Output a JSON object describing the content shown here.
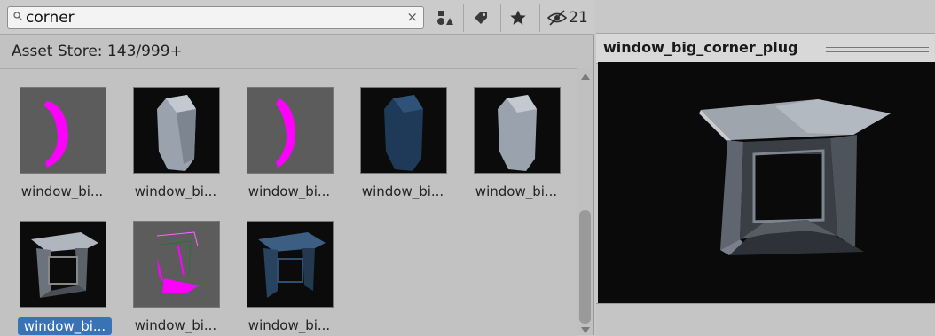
{
  "search": {
    "query": "corner",
    "placeholder": ""
  },
  "toolbar": {
    "clear_label": "×",
    "hidden_count": "21",
    "icons": [
      "search-icon",
      "clear-icon",
      "filter-by-type-icon",
      "filter-by-label-icon",
      "favorites-star-icon",
      "hidden-visibility-icon"
    ]
  },
  "asset_store": {
    "label": "Asset Store: 143/999+"
  },
  "assets": [
    {
      "label": "window_bi...",
      "thumb_style": "grey",
      "shape": "magenta-arc"
    },
    {
      "label": "window_bi...",
      "thumb_style": "dark",
      "shape": "grey-prism"
    },
    {
      "label": "window_bi...",
      "thumb_style": "grey",
      "shape": "magenta-arc"
    },
    {
      "label": "window_bi...",
      "thumb_style": "dark",
      "shape": "blue-prism"
    },
    {
      "label": "window_bi...",
      "thumb_style": "dark",
      "shape": "grey-prism"
    },
    {
      "label": "window_bi...",
      "thumb_style": "dark",
      "shape": "grey-corner",
      "selected": true
    },
    {
      "label": "window_bi...",
      "thumb_style": "grey",
      "shape": "magenta-corner"
    },
    {
      "label": "window_bi...",
      "thumb_style": "dark",
      "shape": "blue-corner"
    }
  ],
  "preview": {
    "title": "window_big_corner_plug"
  },
  "colors": {
    "selection": "#3a72b6",
    "magenta": "#ff00ff",
    "panel_bg": "#c2c2c2",
    "preview_bg": "#0a0a0a"
  }
}
